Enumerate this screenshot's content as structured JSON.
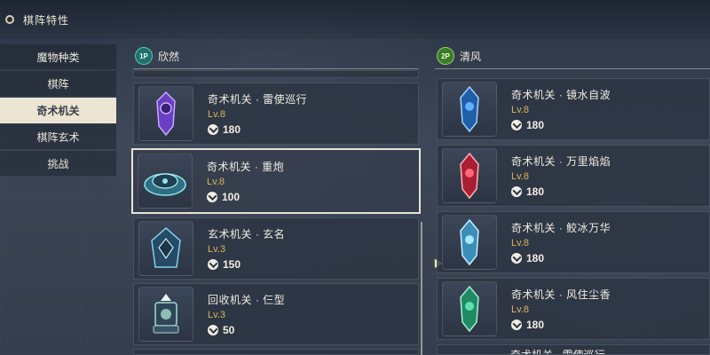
{
  "header": {
    "title": "棋阵特性",
    "icon": "circle-icon"
  },
  "sidebar": {
    "items": [
      {
        "label": "魔物种类",
        "active": false
      },
      {
        "label": "棋阵",
        "active": false
      },
      {
        "label": "奇术机关",
        "active": true
      },
      {
        "label": "棋阵玄术",
        "active": false
      },
      {
        "label": "挑战",
        "active": false
      }
    ]
  },
  "player1": {
    "badge": "1P",
    "name": "欣然",
    "cards": [
      {
        "name": "奇术机关 · 雷使巡行",
        "level": "Lv.8",
        "cost": "180",
        "color": "#7b4fd6"
      },
      {
        "name": "奇术机关 · 重炮",
        "level": "Lv.8",
        "cost": "100",
        "color": "#4fb6c9",
        "selected": true
      },
      {
        "name": "玄术机关 · 玄名",
        "level": "Lv.3",
        "cost": "150",
        "color": "#3f8fb0"
      },
      {
        "name": "回收机关 · 仨型",
        "level": "Lv.3",
        "cost": "50",
        "color": "#9fd3c6"
      }
    ]
  },
  "player2": {
    "badge": "2P",
    "name": "清风",
    "cards": [
      {
        "name": "奇术机关 · 镜水自波",
        "level": "Lv.8",
        "cost": "180",
        "color": "#2f8fe0"
      },
      {
        "name": "奇术机关 · 万里焰焰",
        "level": "Lv.8",
        "cost": "180",
        "color": "#d8374a"
      },
      {
        "name": "奇术机关 · 鲛冰万华",
        "level": "Lv.8",
        "cost": "180",
        "color": "#58c0e0"
      },
      {
        "name": "奇术机关 · 风住尘香",
        "level": "Lv.8",
        "cost": "180",
        "color": "#3fc49a"
      }
    ],
    "partial_name": "奇术机关 · 雷使巡行"
  },
  "colors": {
    "accent": "#d9b45e",
    "active_tab": "#ece5d3",
    "selection_border": "#e7e3d6"
  }
}
